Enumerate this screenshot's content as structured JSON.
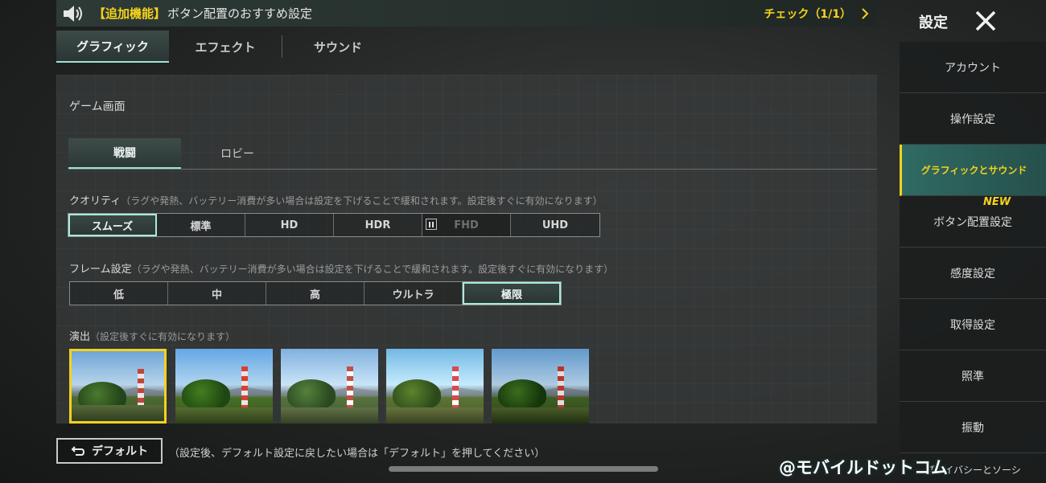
{
  "banner": {
    "tag": "【追加機能】",
    "message": "ボタン配置のおすすめ設定",
    "check": "チェック（1/1）"
  },
  "top_tabs": [
    "グラフィック",
    "エフェクト",
    "サウンド"
  ],
  "panel": {
    "section_title": "ゲーム画面",
    "sub_tabs": [
      "戦闘",
      "ロビー"
    ],
    "quality": {
      "label": "クオリティ",
      "hint": "（ラグや発熱、バッテリー消費が多い場合は設定を下げることで緩和されます。設定後すぐに有効になります）",
      "options": [
        "スムーズ",
        "標準",
        "HD",
        "HDR",
        "FHD",
        "UHD"
      ],
      "selected": "スムーズ"
    },
    "frame": {
      "label": "フレーム設定",
      "hint": "（ラグや発熱、バッテリー消費が多い場合は設定を下げることで緩和されます。設定後すぐに有効になります）",
      "options": [
        "低",
        "中",
        "高",
        "ウルトラ",
        "極限"
      ],
      "selected": "極限"
    },
    "style": {
      "label": "演出",
      "hint": "（設定後すぐに有効になります）"
    }
  },
  "footer": {
    "default_label": "デフォルト",
    "note": "（設定後、デフォルト設定に戻したい場合は「デフォルト」を押してください）"
  },
  "sidebar": {
    "title": "設定",
    "items": [
      "アカウント",
      "操作設定",
      "グラフィックとサウンド",
      "ボタン配置設定",
      "感度設定",
      "取得設定",
      "照準",
      "振動",
      "プライバシーとソーシ"
    ],
    "new_badge": "NEW"
  },
  "watermark": "@モバイルドットコム",
  "colors": {
    "accent": "#a8ebde",
    "highlight": "#f5d21c"
  }
}
